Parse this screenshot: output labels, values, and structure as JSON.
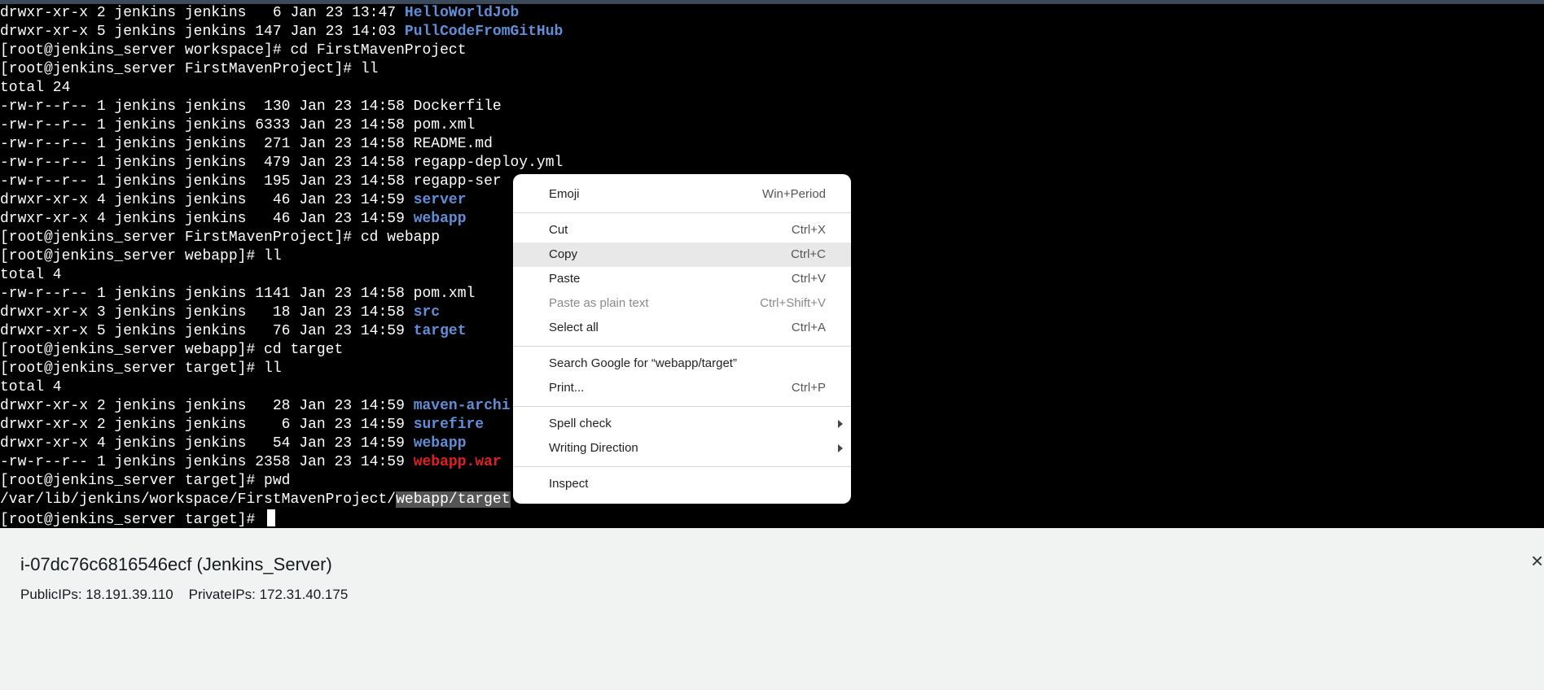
{
  "terminal": {
    "lines": [
      [
        {
          "t": "drwxr-xr-x 2 jenkins jenkins   6 Jan 23 13:47 "
        },
        {
          "t": "HelloWorldJob",
          "c": "dir"
        }
      ],
      [
        {
          "t": "drwxr-xr-x 5 jenkins jenkins 147 Jan 23 14:03 "
        },
        {
          "t": "PullCodeFromGitHub",
          "c": "dir"
        }
      ],
      [
        {
          "t": "[root@jenkins_server workspace]# cd FirstMavenProject"
        }
      ],
      [
        {
          "t": "[root@jenkins_server FirstMavenProject]# ll"
        }
      ],
      [
        {
          "t": "total 24"
        }
      ],
      [
        {
          "t": "-rw-r--r-- 1 jenkins jenkins  130 Jan 23 14:58 Dockerfile"
        }
      ],
      [
        {
          "t": "-rw-r--r-- 1 jenkins jenkins 6333 Jan 23 14:58 pom.xml"
        }
      ],
      [
        {
          "t": "-rw-r--r-- 1 jenkins jenkins  271 Jan 23 14:58 README.md"
        }
      ],
      [
        {
          "t": "-rw-r--r-- 1 jenkins jenkins  479 Jan 23 14:58 regapp-deploy.yml"
        }
      ],
      [
        {
          "t": "-rw-r--r-- 1 jenkins jenkins  195 Jan 23 14:58 regapp-ser"
        }
      ],
      [
        {
          "t": "drwxr-xr-x 4 jenkins jenkins   46 Jan 23 14:59 "
        },
        {
          "t": "server",
          "c": "dir"
        }
      ],
      [
        {
          "t": "drwxr-xr-x 4 jenkins jenkins   46 Jan 23 14:59 "
        },
        {
          "t": "webapp",
          "c": "dir"
        }
      ],
      [
        {
          "t": "[root@jenkins_server FirstMavenProject]# cd webapp"
        }
      ],
      [
        {
          "t": "[root@jenkins_server webapp]# ll"
        }
      ],
      [
        {
          "t": "total 4"
        }
      ],
      [
        {
          "t": "-rw-r--r-- 1 jenkins jenkins 1141 Jan 23 14:58 pom.xml"
        }
      ],
      [
        {
          "t": "drwxr-xr-x 3 jenkins jenkins   18 Jan 23 14:58 "
        },
        {
          "t": "src",
          "c": "dir"
        }
      ],
      [
        {
          "t": "drwxr-xr-x 5 jenkins jenkins   76 Jan 23 14:59 "
        },
        {
          "t": "target",
          "c": "dir"
        }
      ],
      [
        {
          "t": "[root@jenkins_server webapp]# cd target"
        }
      ],
      [
        {
          "t": "[root@jenkins_server target]# ll"
        }
      ],
      [
        {
          "t": "total 4"
        }
      ],
      [
        {
          "t": "drwxr-xr-x 2 jenkins jenkins   28 Jan 23 14:59 "
        },
        {
          "t": "maven-archi",
          "c": "dir"
        }
      ],
      [
        {
          "t": "drwxr-xr-x 2 jenkins jenkins    6 Jan 23 14:59 "
        },
        {
          "t": "surefire",
          "c": "dir"
        }
      ],
      [
        {
          "t": "drwxr-xr-x 4 jenkins jenkins   54 Jan 23 14:59 "
        },
        {
          "t": "webapp",
          "c": "dir"
        }
      ],
      [
        {
          "t": "-rw-r--r-- 1 jenkins jenkins 2358 Jan 23 14:59 "
        },
        {
          "t": "webapp.war",
          "c": "war"
        }
      ],
      [
        {
          "t": "[root@jenkins_server target]# pwd"
        }
      ],
      [
        {
          "t": "/var/lib/jenkins/workspace/FirstMavenProject/"
        },
        {
          "t": "webapp/target",
          "c": "sel"
        }
      ],
      [
        {
          "t": "[root@jenkins_server target]# "
        },
        {
          "t": "",
          "c": "cursor"
        }
      ]
    ]
  },
  "context_menu": {
    "groups": [
      [
        {
          "label": "Emoji",
          "shortcut": "Win+Period"
        }
      ],
      [
        {
          "label": "Cut",
          "shortcut": "Ctrl+X"
        },
        {
          "label": "Copy",
          "shortcut": "Ctrl+C",
          "active": true
        },
        {
          "label": "Paste",
          "shortcut": "Ctrl+V"
        },
        {
          "label": "Paste as plain text",
          "shortcut": "Ctrl+Shift+V",
          "disabled": true
        },
        {
          "label": "Select all",
          "shortcut": "Ctrl+A"
        }
      ],
      [
        {
          "label": "Search Google for “webapp/target”",
          "shortcut": ""
        },
        {
          "label": "Print...",
          "shortcut": "Ctrl+P"
        }
      ],
      [
        {
          "label": "Spell check",
          "shortcut": "",
          "submenu": true
        },
        {
          "label": "Writing Direction",
          "shortcut": "",
          "submenu": true
        }
      ],
      [
        {
          "label": "Inspect",
          "shortcut": ""
        }
      ]
    ]
  },
  "instance": {
    "title": "i-07dc76c6816546ecf (Jenkins_Server)",
    "ips": "PublicIPs: 18.191.39.110    PrivateIPs: 172.31.40.175",
    "close": "×"
  }
}
